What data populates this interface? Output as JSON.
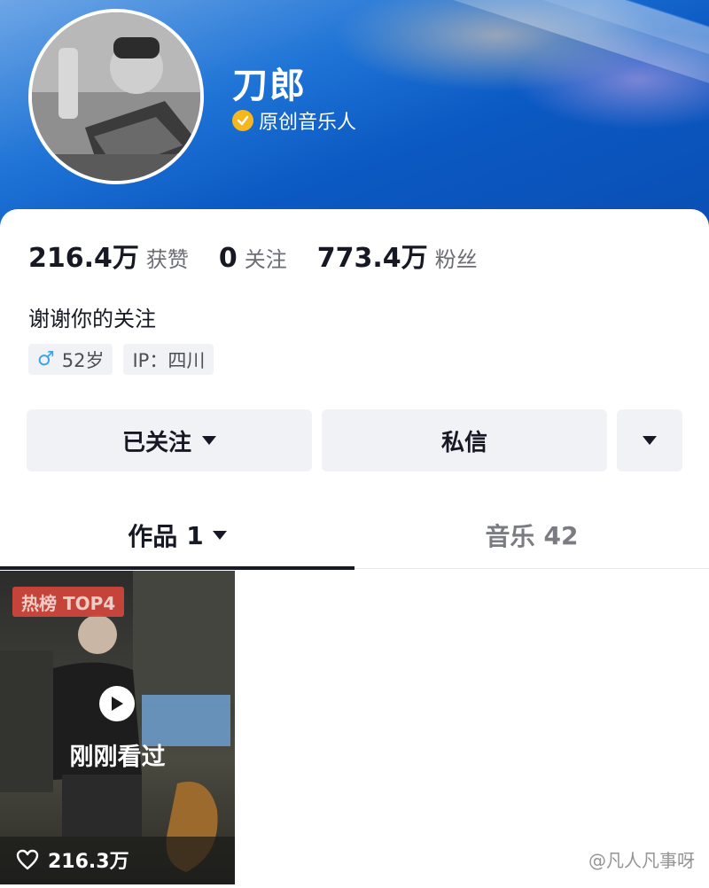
{
  "profile": {
    "name": "刀郎",
    "verification": "原创音乐人",
    "avatar_alt": "avatar"
  },
  "stats": [
    {
      "value": "216.4万",
      "label": "获赞"
    },
    {
      "value": "0",
      "label": "关注"
    },
    {
      "value": "773.4万",
      "label": "粉丝"
    }
  ],
  "bio": "谢谢你的关注",
  "tags": {
    "gender_symbol": "♂",
    "age": "52岁",
    "ip": "IP：四川"
  },
  "actions": {
    "follow_label": "已关注",
    "message_label": "私信"
  },
  "tabs": [
    {
      "label": "作品",
      "count": "1"
    },
    {
      "label": "音乐",
      "count": "42"
    }
  ],
  "video": {
    "hot_badge": "热榜 TOP4",
    "status": "刚刚看过",
    "likes": "216.3万"
  },
  "watermark": "@凡人凡事呀",
  "colors": {
    "header_blue": "#0b59c3",
    "verified_badge": "#f5b71f",
    "hot_badge": "#d2463c",
    "male_icon": "#3aa3f0"
  }
}
